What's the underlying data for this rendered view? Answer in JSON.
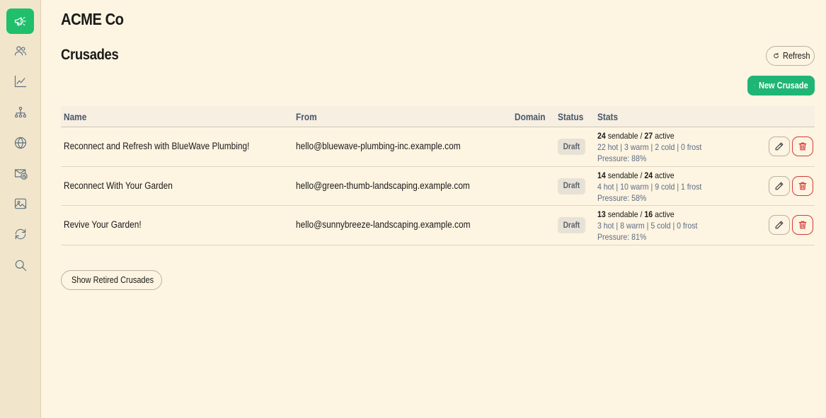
{
  "sidebar": {
    "items": [
      {
        "icon": "megaphone-icon",
        "active": true
      },
      {
        "icon": "users-icon",
        "active": false
      },
      {
        "icon": "chart-line-icon",
        "active": false
      },
      {
        "icon": "hierarchy-icon",
        "active": false
      },
      {
        "icon": "globe-icon",
        "active": false
      },
      {
        "icon": "mail-at-icon",
        "active": false
      },
      {
        "icon": "image-icon",
        "active": false
      },
      {
        "icon": "sync-icon",
        "active": false
      },
      {
        "icon": "search-icon",
        "active": false
      }
    ],
    "accent": "#1fbf6c"
  },
  "header": {
    "org_name": "ACME Co",
    "page_title": "Crusades",
    "refresh_label": "Refresh",
    "new_label": "New Crusade"
  },
  "table": {
    "columns": {
      "name": "Name",
      "from": "From",
      "domain": "Domain",
      "status": "Status",
      "stats": "Stats"
    },
    "rows": [
      {
        "name": "Reconnect and Refresh with BlueWave Plumbing!",
        "from": "hello@bluewave-plumbing-inc.example.com",
        "domain": "",
        "status": "Draft",
        "sendable": "24",
        "sendable_label": "sendable",
        "active": "27",
        "active_label": "active",
        "breakdown": "22 hot | 3 warm | 2 cold | 0 frost",
        "pressure": "Pressure: 88%"
      },
      {
        "name": "Reconnect With Your Garden",
        "from": "hello@green-thumb-landscaping.example.com",
        "domain": "",
        "status": "Draft",
        "sendable": "14",
        "sendable_label": "sendable",
        "active": "24",
        "active_label": "active",
        "breakdown": "4 hot | 10 warm | 9 cold | 1 frost",
        "pressure": "Pressure: 58%"
      },
      {
        "name": "Revive Your Garden!",
        "from": "hello@sunnybreeze-landscaping.example.com",
        "domain": "",
        "status": "Draft",
        "sendable": "13",
        "sendable_label": "sendable",
        "active": "16",
        "active_label": "active",
        "breakdown": "3 hot | 8 warm | 5 cold | 0 frost",
        "pressure": "Pressure: 81%"
      }
    ]
  },
  "footer": {
    "retired_label": "Show Retired Crusades"
  },
  "colors": {
    "background": "#fdf4e1",
    "primary_button": "#1fb574",
    "danger": "#d23a3a"
  }
}
